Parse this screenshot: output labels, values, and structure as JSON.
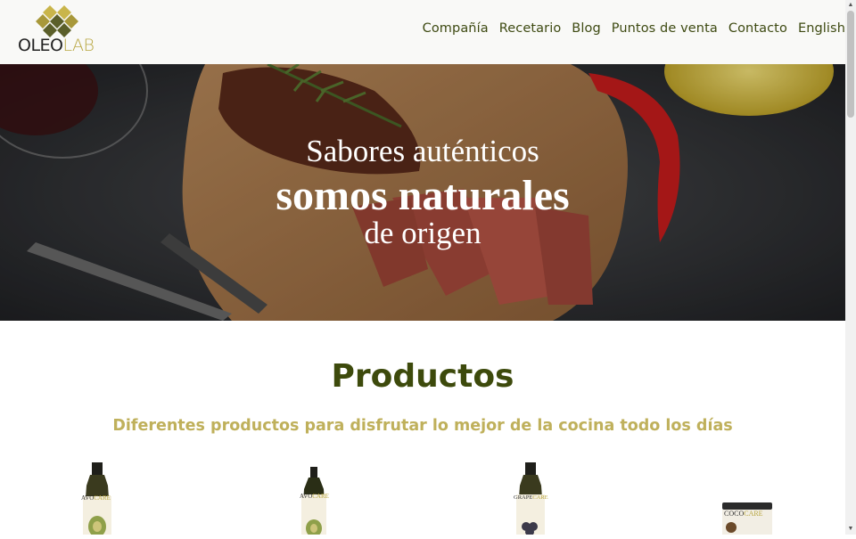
{
  "header": {
    "logo": {
      "part1": "OLEO",
      "part2": "LAB"
    },
    "nav": [
      "Compañía",
      "Recetario",
      "Blog",
      "Puntos de venta",
      "Contacto",
      "English"
    ]
  },
  "hero": {
    "line1": "Sabores auténticos",
    "line2": "somos naturales",
    "line3": "de origen"
  },
  "products": {
    "title": "Productos",
    "subtitle": "Diferentes productos para disfrutar lo mejor de la cocina todo los días",
    "items": [
      {
        "brand_a": "AVO",
        "brand_b": "CARE"
      },
      {
        "brand_a": "AVO",
        "brand_b": "CARE"
      },
      {
        "brand_a": "GRAPE",
        "brand_b": "CARE"
      },
      {
        "brand_a": "COCO",
        "brand_b": "CARE"
      }
    ]
  },
  "colors": {
    "brand_dark": "#3d4a0c",
    "brand_gold": "#bfb05b",
    "nav_text": "#3e4a12"
  },
  "icons": [
    "logo-diamond-icon",
    "scroll-up-icon",
    "scroll-down-icon"
  ]
}
